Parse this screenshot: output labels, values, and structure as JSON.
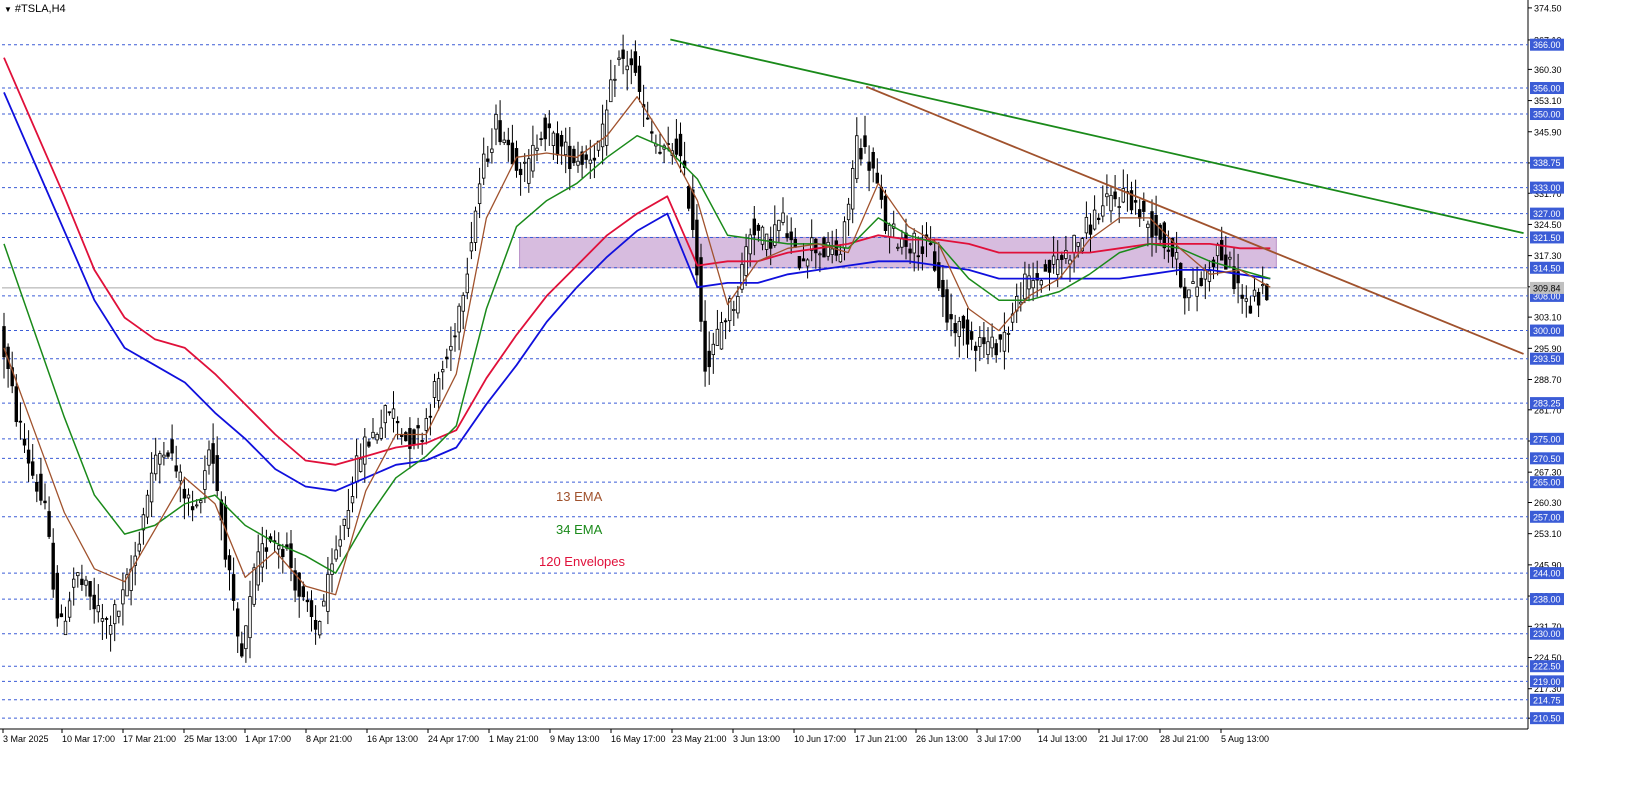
{
  "symbol_label": "#TSLA,H4",
  "colors": {
    "background": "#ffffff",
    "grid_line": "#3b5cd6",
    "candle": "#000000",
    "ema13": "#a0522d",
    "ema34": "#1a8a1a",
    "ema_blue": "#1010dd",
    "envelope_red": "#e0103a",
    "trend_green": "#1a8a1a",
    "trend_brown": "#a0522d",
    "zone_fill": "#c9a6d4",
    "axis_label_bg": "#3b5cd6",
    "axis_label_text": "#ffffff",
    "current_price_bg": "#c0c0c0"
  },
  "annotations": [
    {
      "text": "13 EMA",
      "color": "#a0522d"
    },
    {
      "text": "34 EMA",
      "color": "#1a8a1a"
    },
    {
      "text": "120 Envelopes",
      "color": "#e0103a"
    }
  ],
  "chart_data": {
    "type": "candlestick",
    "title": "#TSLA,H4",
    "ylim": [
      208.0,
      375.4
    ],
    "y_tick_labels": [
      374.5,
      367.1,
      360.3,
      353.1,
      345.9,
      338.7,
      331.7,
      324.5,
      317.3,
      310.1,
      303.1,
      295.9,
      288.7,
      281.7,
      274.5,
      267.3,
      260.3,
      253.1,
      245.9,
      238.7,
      231.7,
      224.5,
      217.3,
      210.5
    ],
    "horizontal_levels": [
      366.0,
      356.0,
      350.0,
      338.75,
      333.0,
      327.0,
      321.5,
      314.5,
      308.0,
      300.0,
      293.5,
      283.25,
      275.0,
      270.5,
      265.0,
      257.0,
      244.0,
      238.0,
      230.0,
      222.5,
      219.0,
      214.75,
      210.5
    ],
    "current_price": 309.84,
    "x_tick_labels": [
      "3 Mar 2025",
      "10 Mar 17:00",
      "17 Mar 21:00",
      "25 Mar 13:00",
      "1 Apr 17:00",
      "8 Apr 21:00",
      "16 Apr 13:00",
      "24 Apr 17:00",
      "1 May 21:00",
      "9 May 13:00",
      "16 May 17:00",
      "23 May 21:00",
      "3 Jun 13:00",
      "10 Jun 17:00",
      "17 Jun 21:00",
      "26 Jun 13:00",
      "3 Jul 17:00",
      "14 Jul 13:00",
      "21 Jul 17:00",
      "28 Jul 21:00",
      "5 Aug 13:00"
    ],
    "price_path": [
      [
        0,
        300
      ],
      [
        0.5,
        282
      ],
      [
        1,
        269
      ],
      [
        1.5,
        258
      ],
      [
        2,
        230
      ],
      [
        2.5,
        244
      ],
      [
        3,
        238
      ],
      [
        3.5,
        232
      ],
      [
        4,
        236
      ],
      [
        4.5,
        248
      ],
      [
        5,
        266
      ],
      [
        5.5,
        275
      ],
      [
        6,
        265
      ],
      [
        6.5,
        257
      ],
      [
        7,
        275
      ],
      [
        7.5,
        250
      ],
      [
        8,
        222
      ],
      [
        8.5,
        245
      ],
      [
        9,
        253
      ],
      [
        9.5,
        250
      ],
      [
        10,
        238
      ],
      [
        10.5,
        231
      ],
      [
        11,
        243
      ],
      [
        11.5,
        258
      ],
      [
        12,
        272
      ],
      [
        12.5,
        277
      ],
      [
        13,
        282
      ],
      [
        13.5,
        275
      ],
      [
        14,
        276
      ],
      [
        14.5,
        287
      ],
      [
        15,
        296
      ],
      [
        15.5,
        314
      ],
      [
        16,
        336
      ],
      [
        16.5,
        348
      ],
      [
        17,
        342
      ],
      [
        17.5,
        336
      ],
      [
        18,
        347
      ],
      [
        18.5,
        343
      ],
      [
        19,
        340
      ],
      [
        19.5,
        340
      ],
      [
        20,
        343
      ],
      [
        20.5,
        362
      ],
      [
        21,
        362
      ],
      [
        21.5,
        348
      ],
      [
        22,
        340
      ],
      [
        22.5,
        343
      ],
      [
        23,
        328
      ],
      [
        23.5,
        290
      ],
      [
        24,
        302
      ],
      [
        24.5,
        308
      ],
      [
        25,
        325
      ],
      [
        25.5,
        320
      ],
      [
        26,
        326
      ],
      [
        26.5,
        316
      ],
      [
        27,
        320
      ],
      [
        27.5,
        318
      ],
      [
        28,
        318
      ],
      [
        28.5,
        344
      ],
      [
        29,
        338
      ],
      [
        29.5,
        323
      ],
      [
        30,
        321
      ],
      [
        30.5,
        320
      ],
      [
        31,
        318
      ],
      [
        31.5,
        303
      ],
      [
        32,
        300
      ],
      [
        32.5,
        298
      ],
      [
        33,
        296
      ],
      [
        33.5,
        300
      ],
      [
        34,
        310
      ],
      [
        34.5,
        312
      ],
      [
        35,
        315
      ],
      [
        35.5,
        318
      ],
      [
        36,
        322
      ],
      [
        36.5,
        327
      ],
      [
        37,
        330
      ],
      [
        37.5,
        332
      ],
      [
        38,
        326
      ],
      [
        38.5,
        323
      ],
      [
        39,
        318
      ],
      [
        39.5,
        308
      ],
      [
        40,
        312
      ],
      [
        40.5,
        319
      ],
      [
        41,
        313
      ],
      [
        41.5,
        305
      ],
      [
        42,
        309
      ]
    ],
    "ema13_path": [
      [
        0,
        296
      ],
      [
        1,
        277
      ],
      [
        2,
        258
      ],
      [
        3,
        245
      ],
      [
        4,
        242
      ],
      [
        5,
        254
      ],
      [
        6,
        266
      ],
      [
        7,
        260
      ],
      [
        8,
        243
      ],
      [
        9,
        249
      ],
      [
        10,
        241
      ],
      [
        11,
        239
      ],
      [
        12,
        263
      ],
      [
        13,
        276
      ],
      [
        14,
        276
      ],
      [
        15,
        290
      ],
      [
        16,
        326
      ],
      [
        17,
        340
      ],
      [
        18,
        341
      ],
      [
        19,
        340
      ],
      [
        20,
        345
      ],
      [
        21,
        354
      ],
      [
        22,
        343
      ],
      [
        23,
        330
      ],
      [
        24,
        306
      ],
      [
        25,
        316
      ],
      [
        26,
        319
      ],
      [
        27,
        320
      ],
      [
        28,
        318
      ],
      [
        29,
        334
      ],
      [
        30,
        324
      ],
      [
        31,
        320
      ],
      [
        32,
        305
      ],
      [
        33,
        300
      ],
      [
        34,
        308
      ],
      [
        35,
        312
      ],
      [
        36,
        321
      ],
      [
        37,
        326
      ],
      [
        38,
        326
      ],
      [
        39,
        319
      ],
      [
        40,
        313
      ],
      [
        41,
        314
      ],
      [
        42,
        310
      ]
    ],
    "ema34_path": [
      [
        0,
        320
      ],
      [
        1,
        300
      ],
      [
        2,
        280
      ],
      [
        3,
        262
      ],
      [
        4,
        253
      ],
      [
        5,
        255
      ],
      [
        6,
        260
      ],
      [
        7,
        262
      ],
      [
        8,
        255
      ],
      [
        9,
        251
      ],
      [
        10,
        248
      ],
      [
        11,
        244
      ],
      [
        12,
        256
      ],
      [
        13,
        266
      ],
      [
        14,
        271
      ],
      [
        15,
        278
      ],
      [
        16,
        305
      ],
      [
        17,
        324
      ],
      [
        18,
        330
      ],
      [
        19,
        334
      ],
      [
        20,
        340
      ],
      [
        21,
        345
      ],
      [
        22,
        342
      ],
      [
        23,
        335
      ],
      [
        24,
        322
      ],
      [
        25,
        321
      ],
      [
        26,
        320
      ],
      [
        27,
        320
      ],
      [
        28,
        319
      ],
      [
        29,
        326
      ],
      [
        30,
        322
      ],
      [
        31,
        320
      ],
      [
        32,
        312
      ],
      [
        33,
        307
      ],
      [
        34,
        307
      ],
      [
        35,
        309
      ],
      [
        36,
        313
      ],
      [
        37,
        318
      ],
      [
        38,
        320
      ],
      [
        39,
        319
      ],
      [
        40,
        316
      ],
      [
        41,
        314
      ],
      [
        42,
        312
      ]
    ],
    "blue_path": [
      [
        0,
        355
      ],
      [
        1,
        339
      ],
      [
        2,
        323
      ],
      [
        3,
        307
      ],
      [
        4,
        296
      ],
      [
        5,
        292
      ],
      [
        6,
        288
      ],
      [
        7,
        281
      ],
      [
        8,
        275
      ],
      [
        9,
        268
      ],
      [
        10,
        264
      ],
      [
        11,
        263
      ],
      [
        12,
        266
      ],
      [
        13,
        269
      ],
      [
        14,
        270
      ],
      [
        15,
        273
      ],
      [
        16,
        283
      ],
      [
        17,
        292
      ],
      [
        18,
        302
      ],
      [
        19,
        310
      ],
      [
        20,
        317
      ],
      [
        21,
        323
      ],
      [
        22,
        327
      ],
      [
        23,
        310
      ],
      [
        24,
        311
      ],
      [
        25,
        311
      ],
      [
        26,
        313
      ],
      [
        27,
        314
      ],
      [
        28,
        315
      ],
      [
        29,
        316
      ],
      [
        30,
        316
      ],
      [
        31,
        315
      ],
      [
        32,
        314
      ],
      [
        33,
        312
      ],
      [
        34,
        312
      ],
      [
        35,
        312
      ],
      [
        36,
        312
      ],
      [
        37,
        312
      ],
      [
        38,
        313
      ],
      [
        39,
        314
      ],
      [
        40,
        314
      ],
      [
        41,
        313
      ],
      [
        42,
        312
      ]
    ],
    "red_path": [
      [
        0,
        363
      ],
      [
        1,
        347
      ],
      [
        2,
        331
      ],
      [
        3,
        314
      ],
      [
        4,
        303
      ],
      [
        5,
        298
      ],
      [
        6,
        296
      ],
      [
        7,
        290
      ],
      [
        8,
        283
      ],
      [
        9,
        276
      ],
      [
        10,
        270
      ],
      [
        11,
        269
      ],
      [
        12,
        271
      ],
      [
        13,
        273
      ],
      [
        14,
        274
      ],
      [
        15,
        277
      ],
      [
        16,
        289
      ],
      [
        17,
        299
      ],
      [
        18,
        308
      ],
      [
        19,
        315
      ],
      [
        20,
        322
      ],
      [
        21,
        327
      ],
      [
        22,
        331
      ],
      [
        23,
        315
      ],
      [
        24,
        316
      ],
      [
        25,
        316
      ],
      [
        26,
        318
      ],
      [
        27,
        319
      ],
      [
        28,
        320
      ],
      [
        29,
        322
      ],
      [
        30,
        321
      ],
      [
        31,
        321
      ],
      [
        32,
        320
      ],
      [
        33,
        318
      ],
      [
        34,
        318
      ],
      [
        35,
        318
      ],
      [
        36,
        318
      ],
      [
        37,
        319
      ],
      [
        38,
        320
      ],
      [
        39,
        320
      ],
      [
        40,
        320
      ],
      [
        41,
        319
      ],
      [
        42,
        319
      ]
    ],
    "green_trendline": [
      [
        22.1,
        367.2
      ],
      [
        50.4,
        322.5
      ]
    ],
    "brown_trendline": [
      [
        28.6,
        356.3
      ],
      [
        50.4,
        294.6
      ]
    ],
    "resistance_zone": {
      "x_start": 17.1,
      "x_end": 42.2,
      "y_low": 314.5,
      "y_high": 321.5
    }
  }
}
